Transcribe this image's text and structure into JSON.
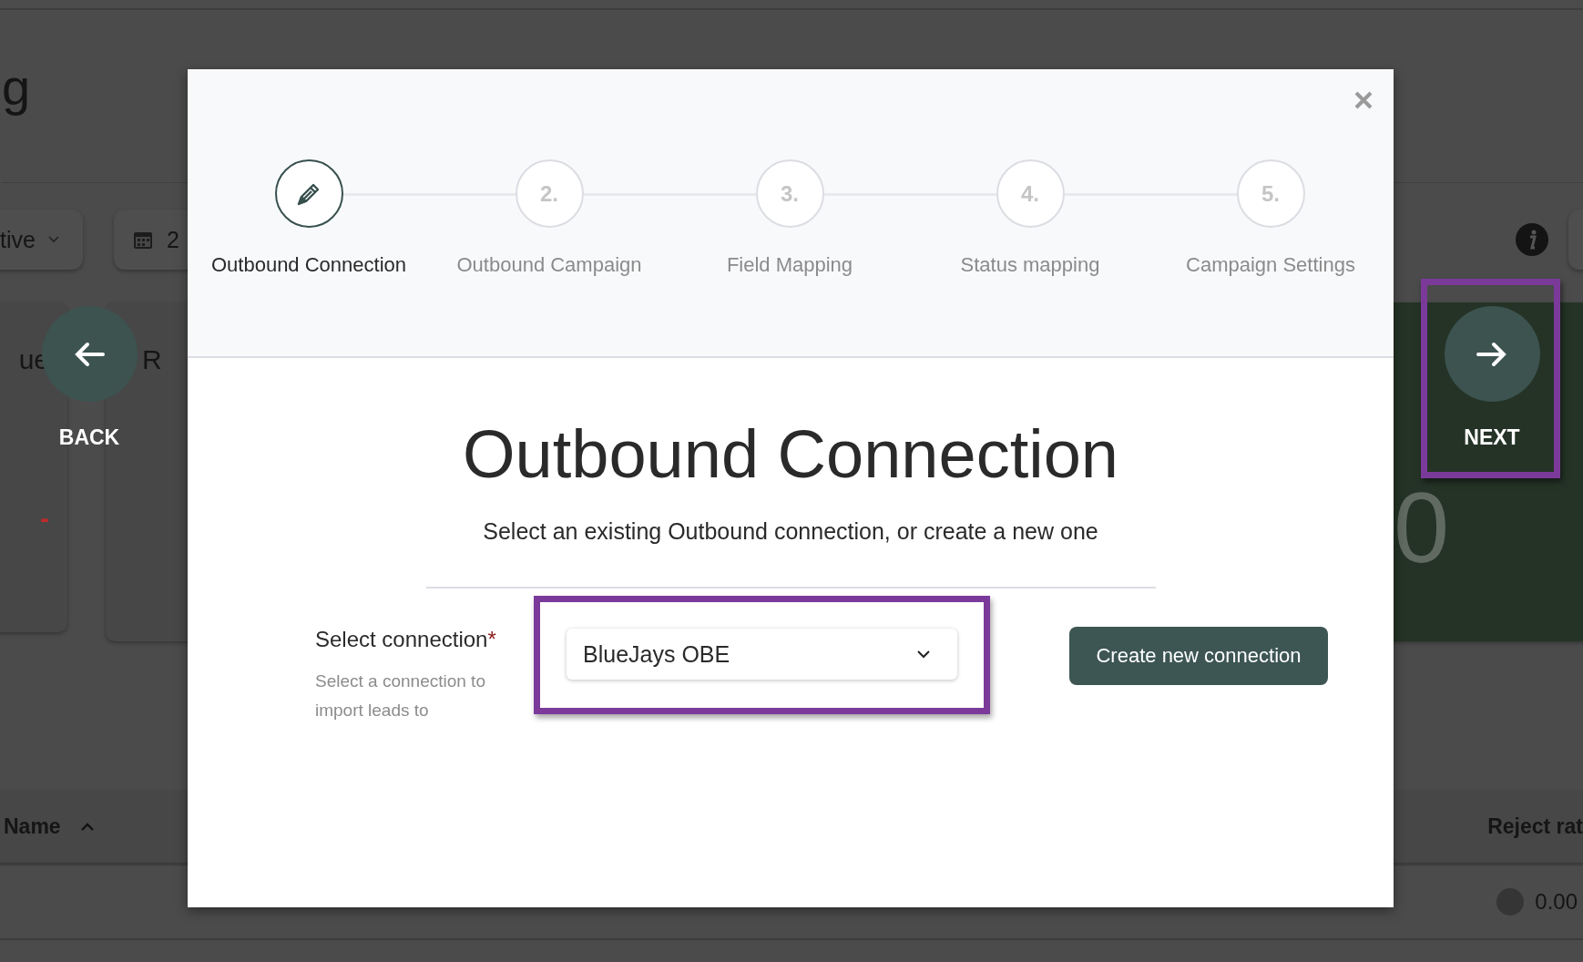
{
  "background": {
    "heading": "g",
    "filter": "tive",
    "date": "2",
    "cards": [
      {
        "label": "ue",
        "value": "-"
      },
      {
        "label": "R"
      }
    ],
    "success_card": {
      "value": "0"
    },
    "table": {
      "columns": [
        "Name",
        "Reject rat"
      ],
      "rows": [
        {
          "reject_rate": "0.00"
        }
      ]
    }
  },
  "nav": {
    "back": "BACK",
    "next": {
      "label": "NEXT",
      "highlighted": true
    }
  },
  "modal": {
    "steps": [
      {
        "label": "Outbound Connection",
        "selected": true
      },
      {
        "number": "2.",
        "label": "Outbound Campaign",
        "selected": false
      },
      {
        "number": "3.",
        "label": "Field Mapping",
        "selected": false
      },
      {
        "number": "4.",
        "label": "Status mapping",
        "selected": false
      },
      {
        "number": "5.",
        "label": "Campaign Settings",
        "selected": false
      }
    ],
    "title": "Outbound Connection",
    "subtitle": "Select an existing Outbound connection, or create a new one",
    "field": {
      "label": "Select connection",
      "required_mark": "*",
      "help": "Select a connection to import leads to",
      "value": "BlueJays OBE",
      "highlighted": true
    },
    "button": "Create new connection"
  }
}
